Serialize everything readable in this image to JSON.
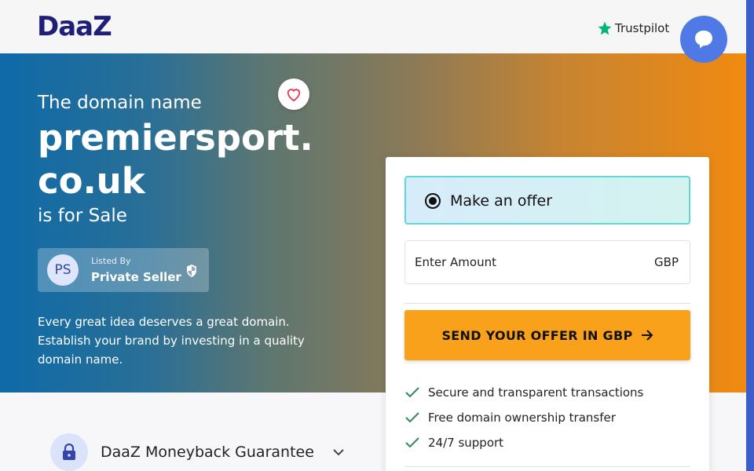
{
  "header": {
    "logo": "DaaZ",
    "trustpilot_label": "Trustpilot",
    "trustpilot_icon": "star-icon",
    "chat_icon": "chat-bubble-icon"
  },
  "hero": {
    "subtitle": "The domain name",
    "domain_line1": "premiersport.",
    "domain_line2": "co.uk",
    "sale_text": "is for Sale",
    "favorite_icon": "heart-icon",
    "seller": {
      "initials": "PS",
      "listed_by": "Listed By",
      "name": "Private Seller",
      "badge_icon": "shield-icon"
    },
    "description_line1": "Every great idea deserves a great domain.",
    "description_line2": "Establish your brand by investing in a quality",
    "description_line3": "domain name."
  },
  "guarantee": {
    "label": "DaaZ Moneyback Guarantee",
    "icon": "lock-icon",
    "toggle_icon": "chevron-down-icon"
  },
  "offer_card": {
    "option_label": "Make an offer",
    "amount_placeholder": "Enter Amount",
    "amount_value": "",
    "currency": "GBP",
    "send_button": "SEND YOUR OFFER IN GBP",
    "features": [
      "Secure and transparent transactions",
      "Free domain ownership transfer",
      "24/7 support"
    ]
  },
  "colors": {
    "brand": "#1f1f7a",
    "accent_button": "#f9a11b",
    "check": "#2e8b57",
    "chat": "#4f7ae6"
  }
}
